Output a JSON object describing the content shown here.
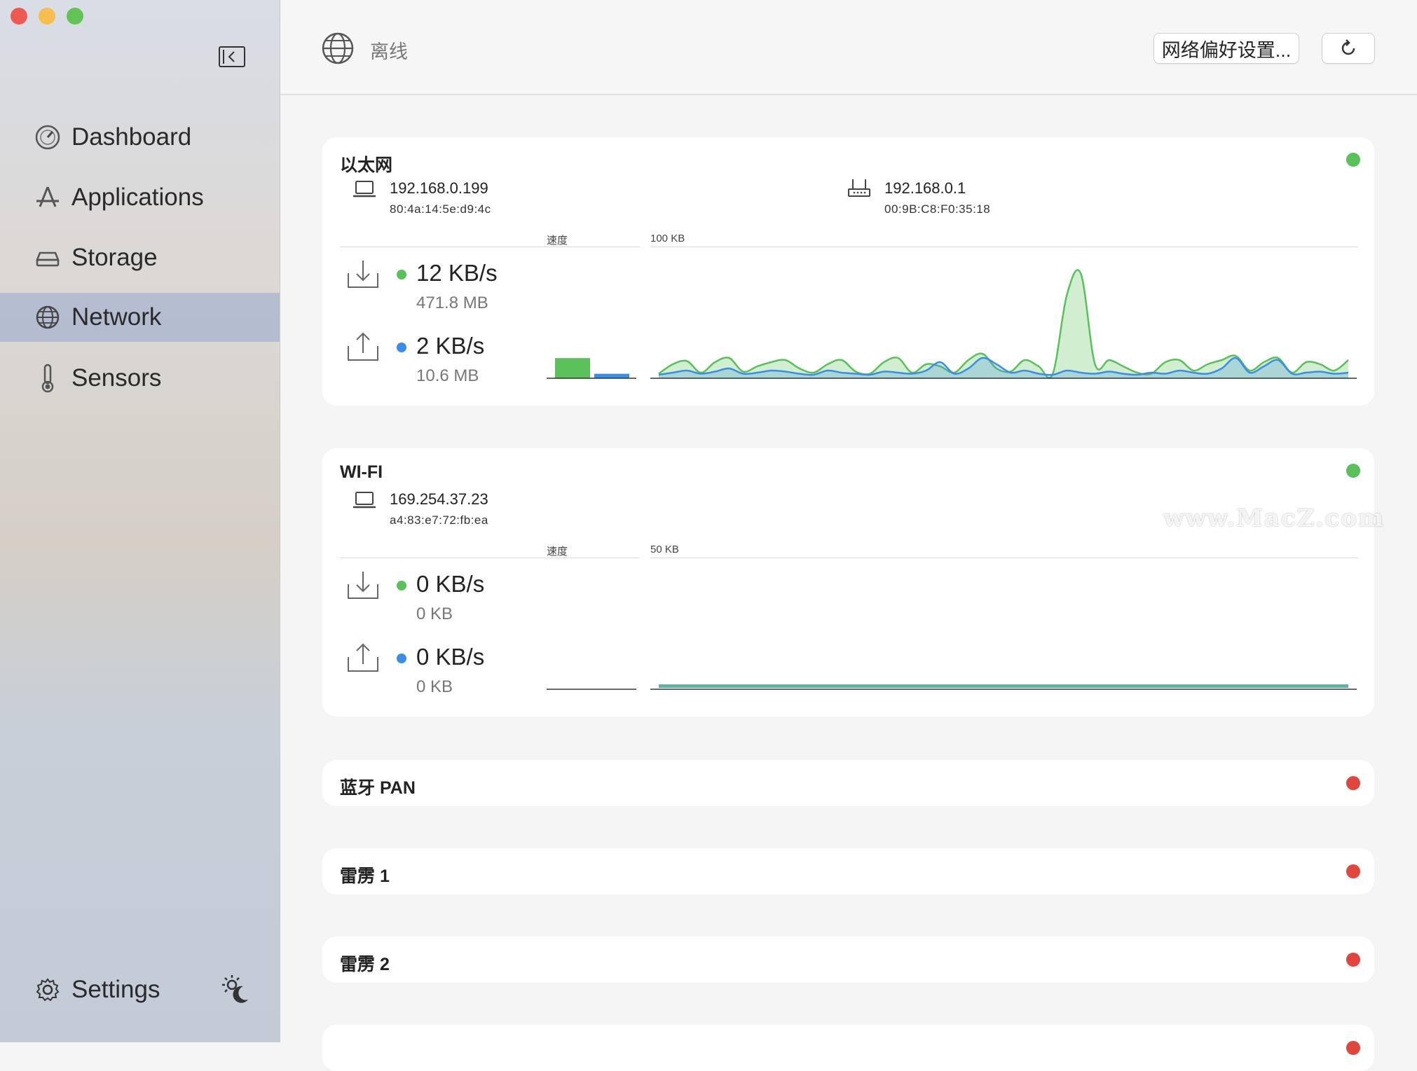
{
  "colors": {
    "green": "#5ac15a",
    "blue": "#3b8ee8",
    "red": "#e0463e",
    "sidebar_selected": "#a9b8d4"
  },
  "sidebar": {
    "items": [
      {
        "label": "Dashboard",
        "icon": "gauge-icon"
      },
      {
        "label": "Applications",
        "icon": "app-store-icon"
      },
      {
        "label": "Storage",
        "icon": "drive-icon"
      },
      {
        "label": "Network",
        "icon": "globe-icon",
        "selected": true
      },
      {
        "label": "Sensors",
        "icon": "thermometer-icon"
      }
    ],
    "settings_label": "Settings"
  },
  "header": {
    "status": "离线",
    "prefs_button": "网络偏好设置...",
    "refresh_icon": "refresh-icon"
  },
  "interfaces": [
    {
      "name": "以太网",
      "status": "connected",
      "local_ip": "192.168.0.199",
      "local_mac": "80:4a:14:5e:d9:4c",
      "router_ip": "192.168.0.1",
      "router_mac": "00:9B:C8:F0:35:18",
      "speed_label": "速度",
      "scale_label": "100 KB",
      "download_speed": "12 KB/s",
      "download_total": "471.8 MB",
      "upload_speed": "2 KB/s",
      "upload_total": "10.6 MB",
      "bar_download": 0.18,
      "bar_upload": 0.04,
      "history_download": [
        3,
        12,
        15,
        4,
        14,
        18,
        5,
        10,
        14,
        16,
        8,
        4,
        12,
        16,
        5,
        3,
        14,
        18,
        4,
        12,
        10,
        4,
        16,
        22,
        8,
        5,
        16,
        10,
        3,
        78,
        98,
        12,
        16,
        10,
        4,
        3,
        14,
        16,
        6,
        12,
        16,
        20,
        6,
        14,
        18,
        4,
        14,
        12,
        6,
        16
      ],
      "history_upload": [
        2,
        4,
        6,
        3,
        5,
        8,
        3,
        4,
        6,
        5,
        3,
        2,
        6,
        4,
        3,
        2,
        5,
        4,
        3,
        6,
        14,
        3,
        8,
        18,
        12,
        4,
        6,
        3,
        2,
        6,
        4,
        3,
        5,
        3,
        2,
        4,
        3,
        6,
        4,
        3,
        8,
        18,
        4,
        10,
        16,
        3,
        4,
        5,
        3,
        4
      ]
    },
    {
      "name": "WI-FI",
      "status": "connected",
      "local_ip": "169.254.37.23",
      "local_mac": "a4:83:e7:72:fb:ea",
      "speed_label": "速度",
      "scale_label": "50 KB",
      "download_speed": "0 KB/s",
      "download_total": "0 KB",
      "upload_speed": "0 KB/s",
      "upload_total": "0 KB"
    },
    {
      "name": "蓝牙 PAN",
      "status": "disconnected"
    },
    {
      "name": "雷雳 1",
      "status": "disconnected"
    },
    {
      "name": "雷雳 2",
      "status": "disconnected"
    }
  ],
  "watermark": "www.MacZ.com"
}
